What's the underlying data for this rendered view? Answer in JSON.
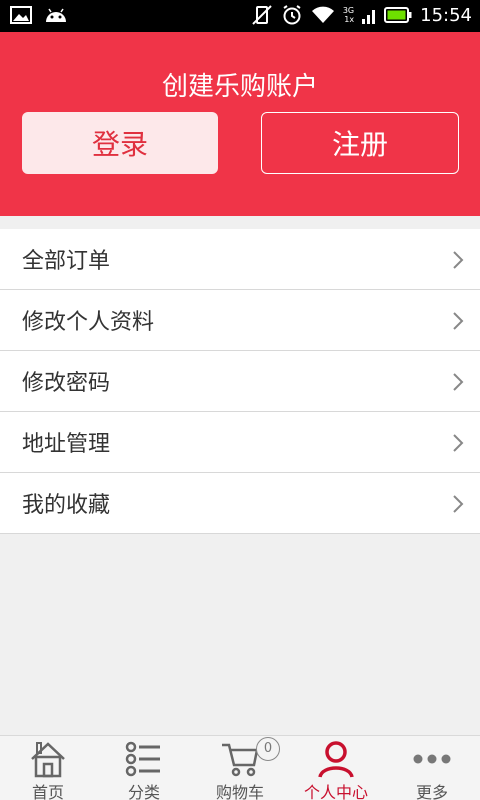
{
  "status_bar": {
    "time": "15:54",
    "network_top": "3G",
    "network_bottom": "1x"
  },
  "header": {
    "title": "创建乐购账户",
    "login_label": "登录",
    "register_label": "注册"
  },
  "menu": {
    "items": [
      {
        "label": "全部订单"
      },
      {
        "label": "修改个人资料"
      },
      {
        "label": "修改密码"
      },
      {
        "label": "地址管理"
      },
      {
        "label": "我的收藏"
      }
    ]
  },
  "tabs": [
    {
      "label": "首页",
      "icon": "home-icon"
    },
    {
      "label": "分类",
      "icon": "list-icon"
    },
    {
      "label": "购物车",
      "icon": "cart-icon",
      "badge": "0"
    },
    {
      "label": "个人中心",
      "icon": "person-icon",
      "active": true
    },
    {
      "label": "更多",
      "icon": "more-icon"
    }
  ],
  "colors": {
    "header_bg": "#f03448",
    "active_tab": "#c8102e"
  }
}
